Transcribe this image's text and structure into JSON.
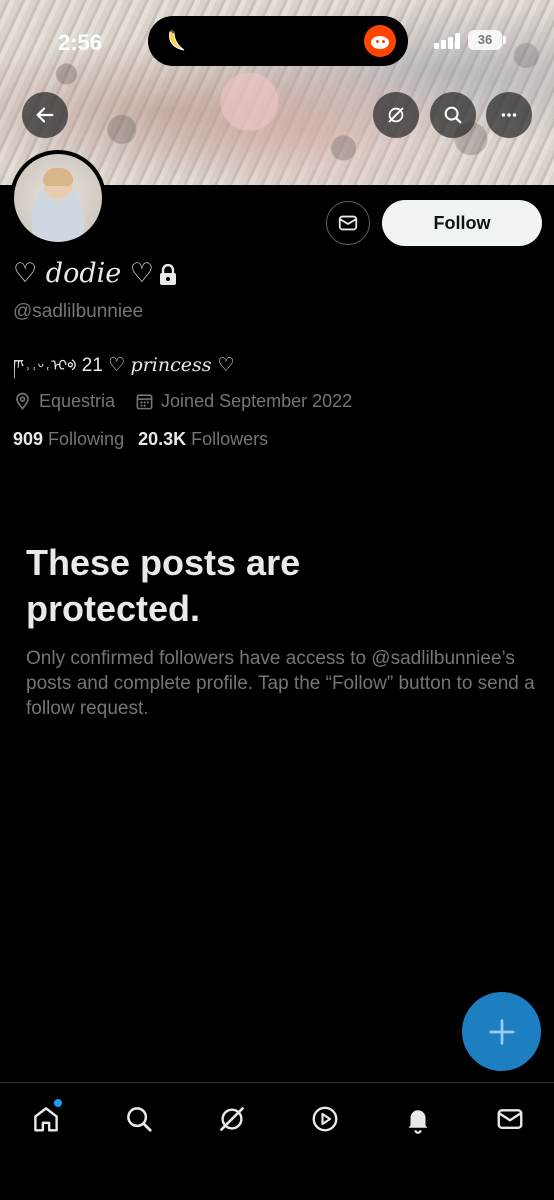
{
  "status_bar": {
    "time": "2:56",
    "battery": "36",
    "icons": [
      "banana-icon",
      "reddit-icon",
      "signal-icon",
      "battery-icon"
    ]
  },
  "banner_actions": {
    "back": "back-arrow-icon",
    "grok": "grok-icon",
    "search": "search-icon",
    "more": "more-icon"
  },
  "profile": {
    "display_name": "♡ dodie ♡",
    "handle": "@sadlilbunniee",
    "bio_script": "ཫ˒˓ᵕ˓ᢈᢀ",
    "bio_text": " 21 ♡ ",
    "bio_italic": "princess ♡",
    "location": "Equestria",
    "joined": "Joined September 2022",
    "following_count": "909",
    "following_label": "Following",
    "followers_count": "20.3K",
    "followers_label": "Followers"
  },
  "actions": {
    "follow_label": "Follow",
    "message_icon": "mail-icon"
  },
  "protected": {
    "title": "These posts are protected.",
    "body": "Only confirmed followers have access to @sadlilbunniee’s posts and complete profile. Tap the “Follow” button to send a follow request."
  },
  "fab": {
    "icon": "plus-icon"
  },
  "bottom_nav": [
    "home-icon",
    "search-icon",
    "grok-icon",
    "video-icon",
    "notifications-icon",
    "messages-icon"
  ],
  "colors": {
    "accent": "#1d9bf0",
    "fab": "#1d7ec2",
    "muted_text": "#71767b",
    "text": "#e7e9ea",
    "background": "#000000"
  }
}
